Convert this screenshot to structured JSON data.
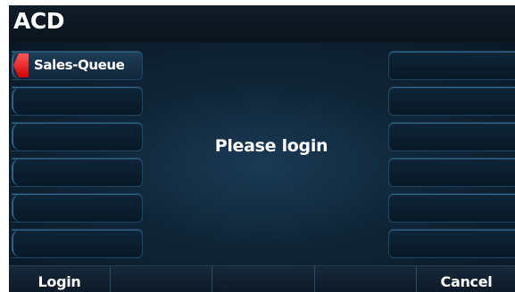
{
  "title": "ACD",
  "left_keys": [
    {
      "label": "Sales-Queue",
      "active": true
    },
    {
      "label": "",
      "active": false
    },
    {
      "label": "",
      "active": false
    },
    {
      "label": "",
      "active": false
    },
    {
      "label": "",
      "active": false
    },
    {
      "label": "",
      "active": false
    }
  ],
  "right_keys": [
    {
      "label": ""
    },
    {
      "label": ""
    },
    {
      "label": ""
    },
    {
      "label": ""
    },
    {
      "label": ""
    },
    {
      "label": ""
    }
  ],
  "message": "Please login",
  "softkeys": [
    "Login",
    "",
    "",
    "",
    "Cancel"
  ],
  "colors": {
    "background": "#0b1824",
    "indicator": "#e00000",
    "text": "#ffffff"
  }
}
